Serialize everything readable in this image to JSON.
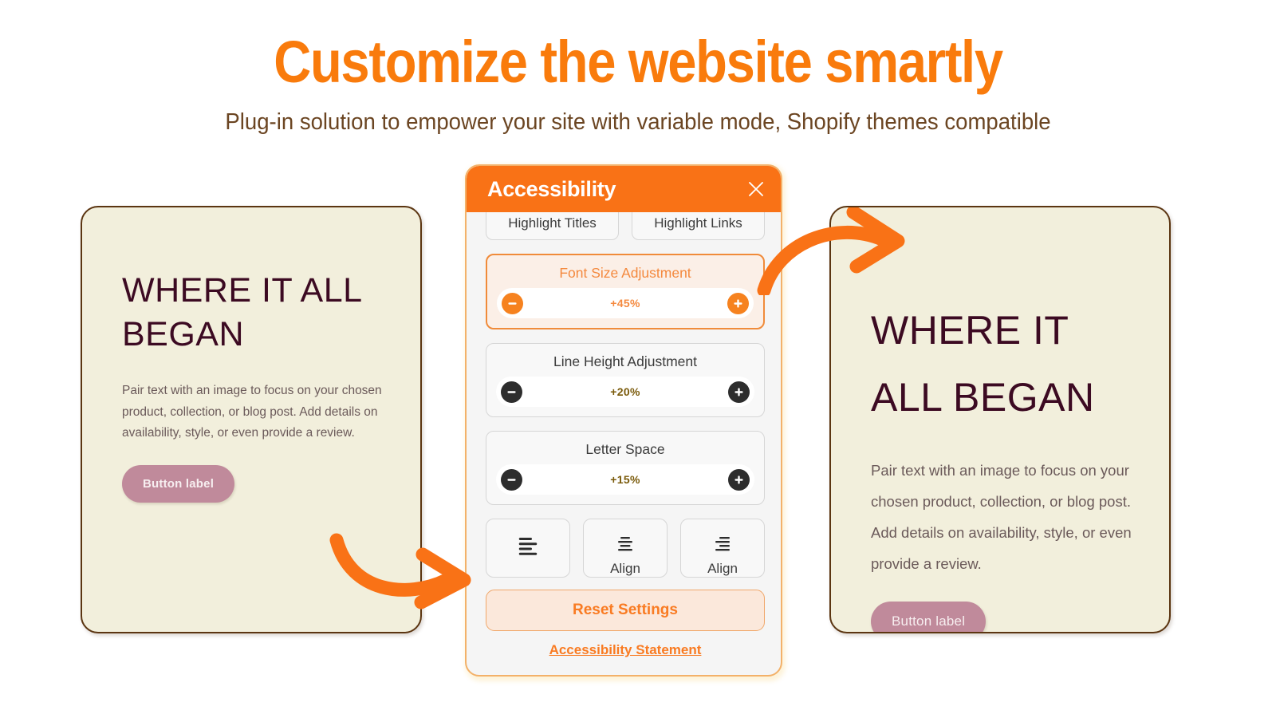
{
  "hero": {
    "title": "Customize the website smartly",
    "subtitle": "Plug-in solution to empower your site with variable mode, Shopify themes compatible",
    "title_color": "#F97B0C",
    "subtitle_color": "#6B4522"
  },
  "cards": {
    "before": {
      "heading": "WHERE IT ALL BEGAN",
      "body": "Pair text with an image to focus on your chosen product, collection, or blog post. Add details on availability, style, or even provide a review.",
      "button_label": "Button label",
      "background": "#F2EFDC",
      "border_color": "#5B3511",
      "heading_color": "#3C0A22",
      "button_color": "#C08A9B"
    },
    "after": {
      "heading": "WHERE IT ALL BEGAN",
      "body": "Pair text with an image to focus on your chosen product, collection, or blog post. Add details on availability, style, or even provide a review.",
      "button_label": "Button label",
      "background": "#F2EFDC",
      "border_color": "#5B3511",
      "heading_color": "#3C0A22",
      "button_color": "#C08A9B"
    }
  },
  "widget": {
    "title": "Accessibility",
    "header_color": "#F97216",
    "close_icon": "close-icon",
    "highlight_buttons": [
      {
        "label": "Highlight Titles",
        "name": "highlight-titles-button"
      },
      {
        "label": "Highlight Links",
        "name": "highlight-links-button"
      }
    ],
    "adjustments": [
      {
        "label": "Font Size Adjustment",
        "value": "+45%",
        "active": true,
        "name": "font-size-adjustment"
      },
      {
        "label": "Line Height Adjustment",
        "value": "+20%",
        "active": false,
        "name": "line-height-adjustment"
      },
      {
        "label": "Letter Space",
        "value": "+15%",
        "active": false,
        "name": "letter-space-adjustment"
      }
    ],
    "align_buttons": [
      {
        "icon": "align-left-icon",
        "label": ""
      },
      {
        "icon": "align-center-icon",
        "label": "Align"
      },
      {
        "icon": "align-right-icon",
        "label": "Align"
      }
    ],
    "reset_label": "Reset Settings",
    "statement_label": "Accessibility Statement",
    "accent_color": "#F97B22"
  },
  "arrows": {
    "color": "#F97216",
    "left_arrow_name": "arrow-before-to-widget",
    "right_arrow_name": "arrow-widget-to-after"
  }
}
